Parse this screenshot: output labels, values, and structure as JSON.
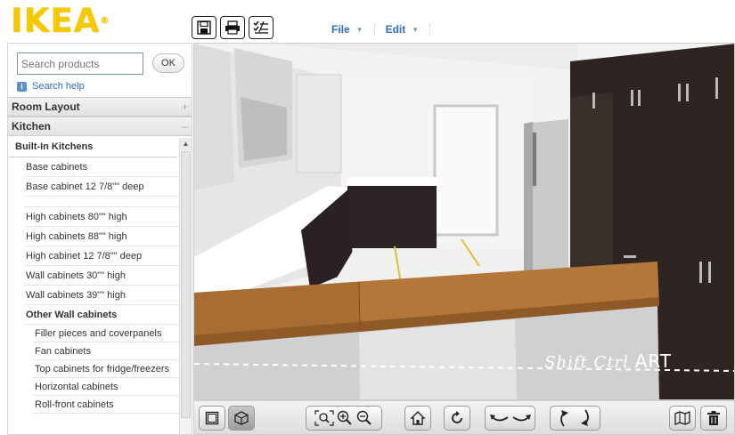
{
  "header": {
    "logo_text": "IKEA",
    "logo_mark": "®",
    "toolbar_icons": [
      "save-icon",
      "print-icon",
      "checklist-icon"
    ],
    "menu": [
      {
        "label": "File"
      },
      {
        "label": "Edit"
      }
    ]
  },
  "sidebar": {
    "search": {
      "placeholder": "Search products",
      "ok_label": "OK"
    },
    "search_help": "Search help",
    "categories": [
      {
        "label": "Room Layout",
        "sign": "+"
      },
      {
        "label": "Kitchen",
        "sign": "–"
      }
    ],
    "subcategory": "Built-In Kitchens",
    "items": [
      "Base cabinets",
      "Base cabinet 12 7/8\"\" deep",
      "High cabinets 80\"\" high",
      "High cabinets 88\"\" high",
      "High cabinet 12 7/8\"\" deep",
      "Wall cabinets 30\"\" high",
      "Wall cabinets 39\"\" high"
    ],
    "group": "Other Wall cabinets",
    "group_items": [
      "Filler pieces and coverpanels",
      "Fan cabinets",
      "Top cabinets for fridge/freezers",
      "Horizontal cabinets",
      "Roll-front cabinets"
    ]
  },
  "view": {
    "watermark": "Shift Ctrl",
    "watermark_art": "ART"
  },
  "colors": {
    "logo_yellow": "#f6c800",
    "menu_blue": "#2a6fc1",
    "countertop": "#b3773a"
  },
  "bottom_toolbar": [
    "2d-view-icon",
    "3d-view-icon",
    "zoom-fit-icon",
    "zoom-in-icon",
    "zoom-out-icon",
    "home-view-icon",
    "rotate-icon",
    "pan-left-icon",
    "pan-right-icon",
    "tilt-up-icon",
    "tilt-down-icon",
    "floor-plan-icon",
    "trash-icon"
  ]
}
